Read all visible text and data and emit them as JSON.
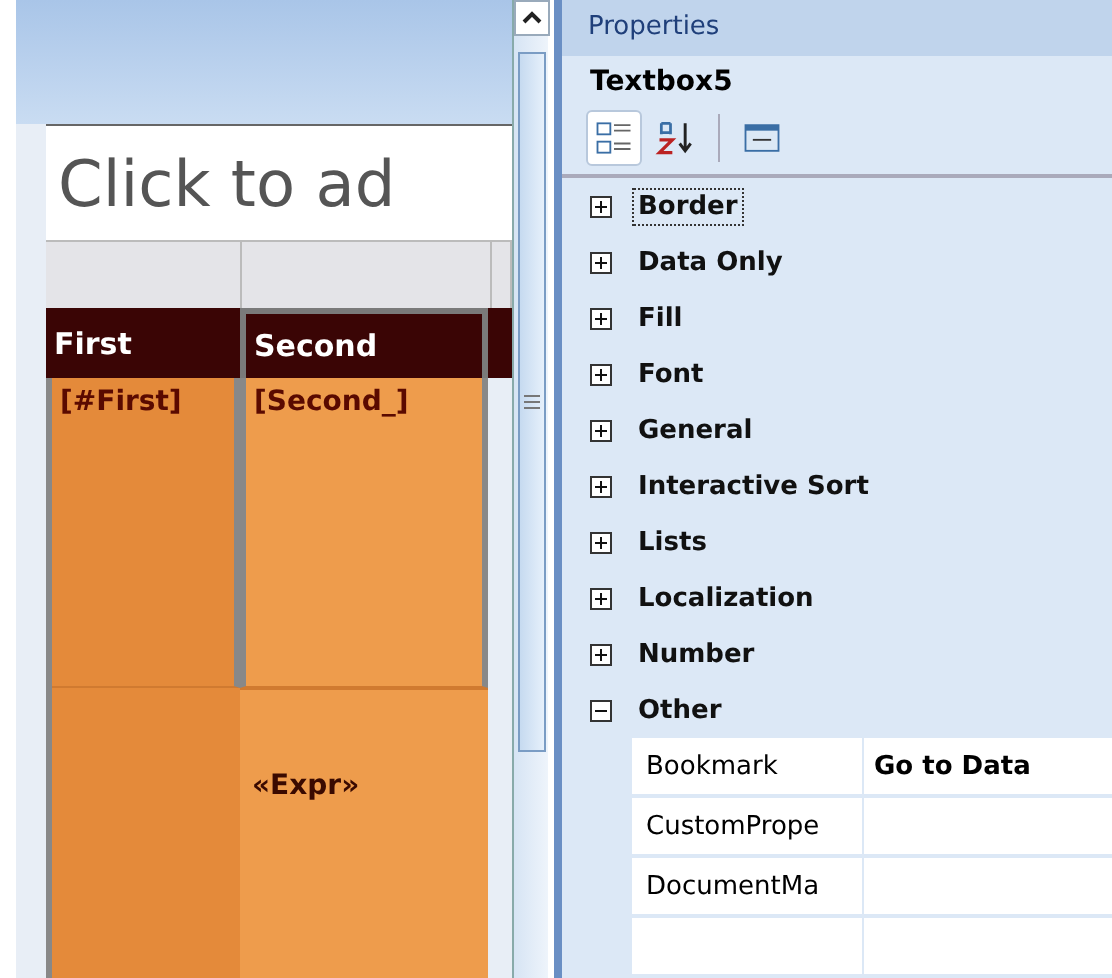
{
  "report": {
    "title_placeholder": "Click to ad",
    "columns": [
      {
        "header": "First",
        "field": "[#First]"
      },
      {
        "header": "Second",
        "field": "[Second_]"
      }
    ],
    "footer_expression": "«Expr»"
  },
  "properties": {
    "title": "Properties",
    "object_name": "Textbox5",
    "categories": [
      {
        "name": "Border",
        "expanded": false,
        "selected": true
      },
      {
        "name": "Data Only",
        "expanded": false,
        "selected": false
      },
      {
        "name": "Fill",
        "expanded": false,
        "selected": false
      },
      {
        "name": "Font",
        "expanded": false,
        "selected": false
      },
      {
        "name": "General",
        "expanded": false,
        "selected": false
      },
      {
        "name": "Interactive Sort",
        "expanded": false,
        "selected": false
      },
      {
        "name": "Lists",
        "expanded": false,
        "selected": false
      },
      {
        "name": "Localization",
        "expanded": false,
        "selected": false
      },
      {
        "name": "Number",
        "expanded": false,
        "selected": false
      },
      {
        "name": "Other",
        "expanded": true,
        "selected": false,
        "children": [
          {
            "name": "Bookmark",
            "value": "Go to Data"
          },
          {
            "name": "CustomPrope"
          },
          {
            "name": "DocumentMa"
          }
        ]
      }
    ]
  }
}
